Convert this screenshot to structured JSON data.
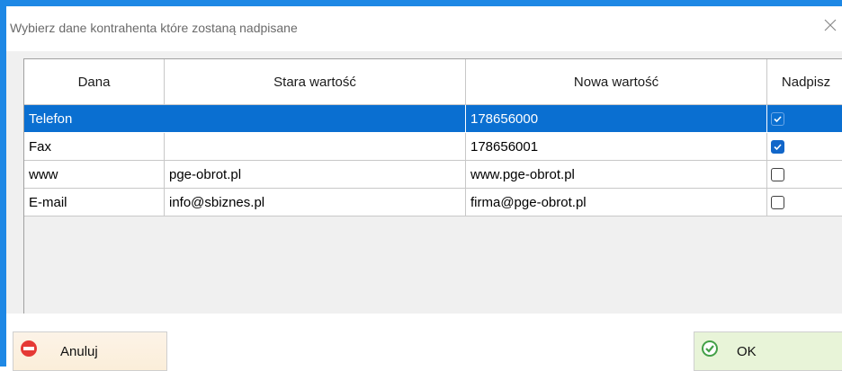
{
  "window": {
    "title": "Wybierz dane kontrahenta które zostaną nadpisane"
  },
  "grid": {
    "columns": [
      "Dana",
      "Stara wartość",
      "Nowa wartość",
      "Nadpisz"
    ],
    "rows": [
      {
        "dana": "Telefon",
        "stara": "",
        "nowa": "178656000",
        "nadpisz": true,
        "selected": true
      },
      {
        "dana": "Fax",
        "stara": "",
        "nowa": "178656001",
        "nadpisz": true,
        "selected": false
      },
      {
        "dana": "www",
        "stara": "pge-obrot.pl",
        "nowa": "www.pge-obrot.pl",
        "nadpisz": false,
        "selected": false
      },
      {
        "dana": "E-mail",
        "stara": "info@sbiznes.pl",
        "nowa": "firma@pge-obrot.pl",
        "nadpisz": false,
        "selected": false
      }
    ]
  },
  "footer": {
    "cancel_label": "Anuluj",
    "cancel_icon": "no-entry-icon",
    "ok_label": "OK",
    "ok_icon": "check-circle-icon"
  },
  "colors": {
    "accent": "#1e88e5",
    "selection": "#0a6fd1",
    "checkbox_checked": "#1266c9"
  }
}
